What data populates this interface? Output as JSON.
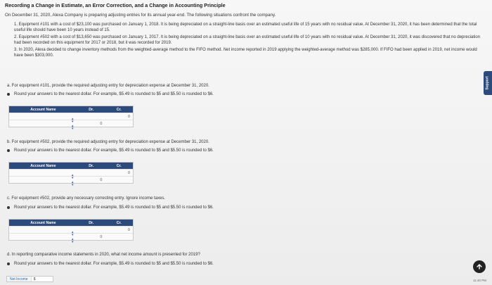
{
  "title": "Recording a Change in Estimate, an Error Correction, and a Change in Accounting Principle",
  "intro": "On December 31, 2020, Alexa Company is preparing adjusting entries for its annual year-end. The following situations confront the company.",
  "situations": [
    "1. Equipment #101 with a cost of $23,100 was purchased on January 1, 2018. It is being depreciated on a straight-line basis over an estimated useful life of 15 years with no residual value. At December 31, 2020, it has been determined that the total useful life should have been 10 years instead of 15.",
    "2. Equipment #502 with a cost of $13,650 was purchased on January 1, 2017. It is being depreciated on a straight-line basis over an estimated useful life of 10 years with no residual value. At December 31, 2020, it was discovered that no depreciation had been recorded on this equipment for 2017 or 2018, but it was recorded for 2019.",
    "3. In 2020, Alexa decided to change inventory methods from the weighted-average method to the FIFO method. Net income reported in 2019 applying the weighted-average method was $285,000. If FIFO had been applied in 2019, net income would have been $303,000."
  ],
  "rounding": "Round your answers to the nearest dollar. For example, $5.49 is rounded to $5 and $5.50 is rounded to $6.",
  "parts": {
    "a": "a. For equipment #101, provide the required adjusting entry for depreciation expense at December 31, 2020.",
    "b": "b. For equipment #502, provide the required adjusting entry for depreciation expense at December 31, 2020.",
    "c": "c. For equipment #502, provide any necessary correcting entry. Ignore income taxes.",
    "d": "d. In reporting comparative income statements in 2020, what net income amount is presented for 2019?"
  },
  "table": {
    "col_account": "Account Name",
    "col_dr": "Dr.",
    "col_cr": "Cr.",
    "zero": "0"
  },
  "net_income": {
    "label": "Net Income",
    "currency": "$"
  },
  "support": "Support",
  "clock": "11:40 PM"
}
